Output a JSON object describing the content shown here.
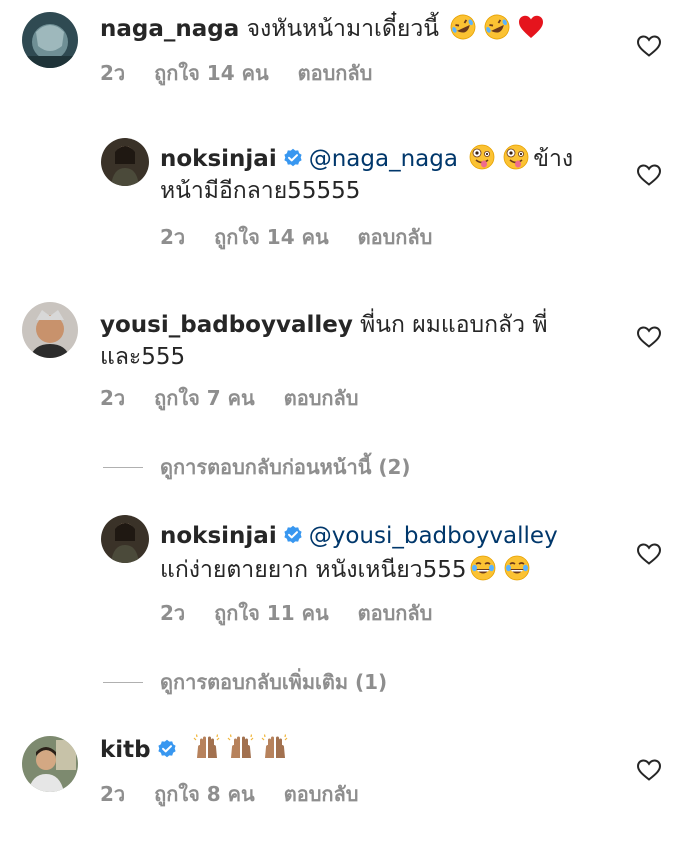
{
  "comments": [
    {
      "username": "naga_naga",
      "text": "จงหันหน้ามาเดี๋ยวนี้",
      "time": "2ว",
      "likes": "ถูกใจ 14 คน",
      "reply": "ตอบกลับ",
      "emojis": [
        "rofl-emoji",
        "rofl-emoji",
        "red-heart-emoji"
      ]
    },
    {
      "username": "noksinjai",
      "mention": "@naga_naga",
      "text_after_emoji": "ข้าง",
      "text_line2": "หน้ามีอีกลาย55555",
      "time": "2ว",
      "likes": "ถูกใจ 14 คน",
      "reply": "ตอบกลับ",
      "emojis": [
        "zany-face-emoji",
        "zany-face-emoji"
      ]
    },
    {
      "username": "yousi_badboyvalley",
      "text": "พี่นก ผมแอบกลัว พี่",
      "text_line2": "และ555",
      "time": "2ว",
      "likes": "ถูกใจ 7 คน",
      "reply": "ตอบกลับ"
    },
    {
      "username": "noksinjai",
      "mention": "@yousi_badboyvalley",
      "text_line2": "แก่ง่ายตายยาก หนังเหนียว555",
      "time": "2ว",
      "likes": "ถูกใจ 11 คน",
      "reply": "ตอบกลับ",
      "emojis": [
        "tears-of-joy-emoji",
        "tears-of-joy-emoji"
      ]
    },
    {
      "username": "kitb",
      "time": "2ว",
      "likes": "ถูกใจ 8 คน",
      "reply": "ตอบกลับ",
      "emojis": [
        "raised-hands-emoji",
        "raised-hands-emoji",
        "raised-hands-emoji"
      ]
    }
  ],
  "view_previous": "ดูการตอบกลับก่อนหน้านี้ (2)",
  "view_more": "ดูการตอบกลับเพิ่มเติม (1)",
  "colors": {
    "text": "#262626",
    "meta": "#8e8e8e",
    "mention": "#00376b",
    "verified": "#3897f0"
  }
}
